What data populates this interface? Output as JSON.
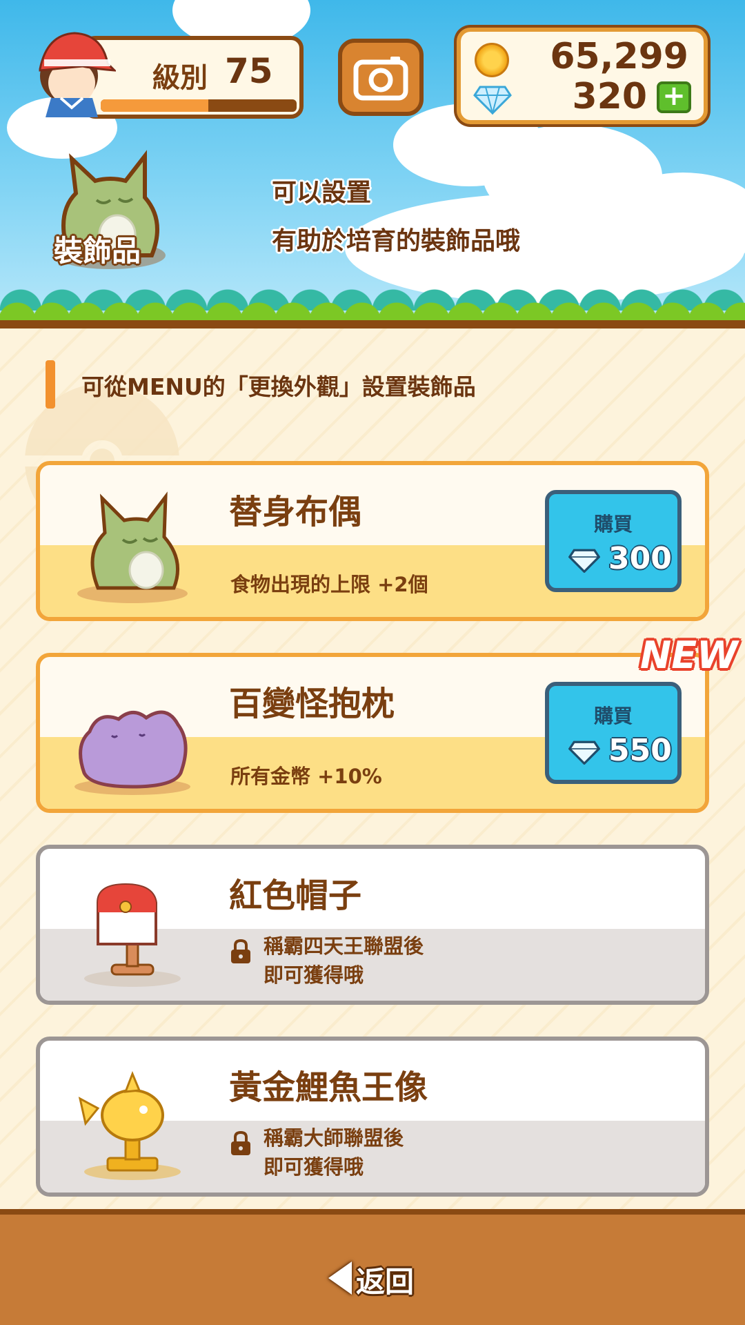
{
  "header": {
    "level_label": "級別",
    "level_value": "75",
    "xp_progress": 0.55,
    "coins": "65,299",
    "gems": "320",
    "add_gems_label": "+"
  },
  "banner": {
    "badge_label": "裝飾品",
    "intro_line1": "可以設置",
    "intro_line2": "有助於培育的裝飾品哦"
  },
  "hint": "可從MENU的「更換外觀」設置裝飾品",
  "items": [
    {
      "name": "替身布偶",
      "effect": "食物出現的上限 +2個",
      "status": "available",
      "buy_label": "購買",
      "price": "300",
      "icon": "substitute-doll-icon"
    },
    {
      "name": "百變怪抱枕",
      "effect": "所有金幣 +10%",
      "status": "available",
      "buy_label": "購買",
      "price": "550",
      "badge": "NEW",
      "icon": "ditto-cushion-icon"
    },
    {
      "name": "紅色帽子",
      "lock_line1": "稱霸四天王聯盟後",
      "lock_line2": "即可獲得哦",
      "status": "locked",
      "icon": "red-cap-icon"
    },
    {
      "name": "黃金鯉魚王像",
      "lock_line1": "稱霸大師聯盟後",
      "lock_line2": "即可獲得哦",
      "status": "locked",
      "icon": "gold-magikarp-statue-icon"
    }
  ],
  "footer": {
    "back_label": "返回"
  },
  "colors": {
    "accent_orange": "#f2a53a",
    "buy_blue": "#33c4ea",
    "brown_text": "#7a3f10",
    "new_red": "#e9422c"
  }
}
